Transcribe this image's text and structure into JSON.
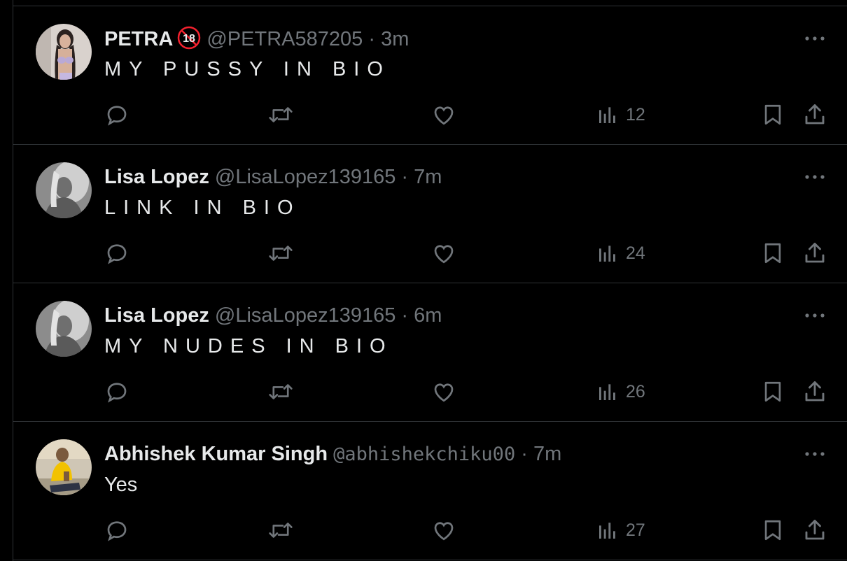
{
  "colors": {
    "background": "#000000",
    "text": "#e7e9ea",
    "muted": "#71767b",
    "border": "#2f3336",
    "badge_red": "#f4212e"
  },
  "tweets": [
    {
      "name": "PETRA",
      "has_18_badge": true,
      "handle": "@PETRA587205",
      "dot": "·",
      "time": "3m",
      "text": "MY PUSSY IN BIO",
      "views": "12",
      "avatar": "photo-woman-lingerie"
    },
    {
      "name": "Lisa Lopez",
      "has_18_badge": false,
      "handle": "@LisaLopez139165",
      "dot": "·",
      "time": "7m",
      "text": "LINK IN BIO",
      "views": "24",
      "avatar": "photo-woman-grayscale"
    },
    {
      "name": "Lisa Lopez",
      "has_18_badge": false,
      "handle": "@LisaLopez139165",
      "dot": "·",
      "time": "6m",
      "text": "MY NUDES IN BIO",
      "views": "26",
      "avatar": "photo-woman-grayscale"
    },
    {
      "name": "Abhishek Kumar Singh",
      "has_18_badge": false,
      "handle": "@abhishekchiku00",
      "dot": "·",
      "time": "7m",
      "text": "Yes",
      "views": "27",
      "avatar": "photo-man-yellow-shirt"
    }
  ],
  "icons": {
    "reply": "reply-icon",
    "retweet": "retweet-icon",
    "like": "like-icon",
    "views": "views-icon",
    "bookmark": "bookmark-icon",
    "share": "share-icon",
    "more": "more-icon"
  }
}
